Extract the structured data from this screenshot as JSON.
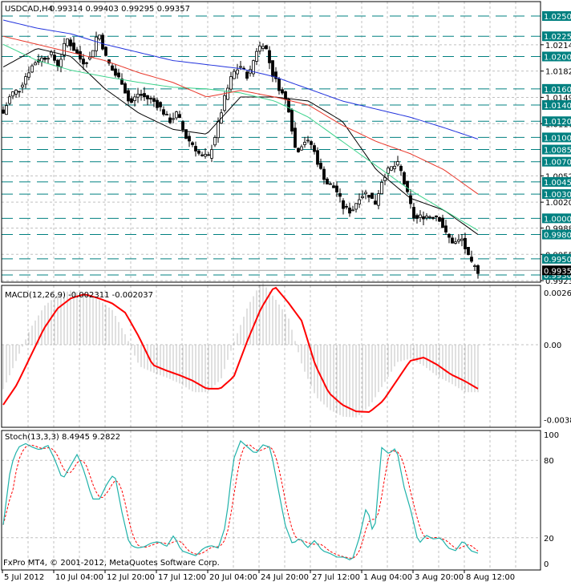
{
  "chart_data": [
    {
      "type": "candlestick",
      "title": "USDCAD,H4",
      "ohlc_text": [
        "0.99314",
        "0.99403",
        "0.99295",
        "0.99357"
      ],
      "current_price": "0.99357",
      "ylim": [
        0.9923,
        1.026
      ],
      "price_scale_labels": [
        "1.02145",
        "1.01820",
        "1.01495",
        "1.01170",
        "1.00525",
        "1.00200",
        "0.99880",
        "0.99555",
        "0.99230"
      ],
      "levels": [
        "1.02500",
        "1.02250",
        "1.02000",
        "1.01600",
        "1.01400",
        "1.01200",
        "1.01000",
        "1.00850",
        "1.00700",
        "1.00450",
        "1.00300",
        "1.00000",
        "0.99800",
        "0.99500",
        "0.99300"
      ],
      "bars": 149,
      "close_path": [
        1.013,
        1.0154,
        1.0159,
        1.0179,
        1.0193,
        1.0198,
        1.0203,
        1.0188,
        1.0223,
        1.0208,
        1.0193,
        1.0198,
        1.0232,
        1.0198,
        1.0179,
        1.0169,
        1.014,
        1.0154,
        1.0149,
        1.0145,
        1.0135,
        1.012,
        1.013,
        1.0101,
        1.0091,
        1.0076,
        1.0076,
        1.011,
        1.0149,
        1.0179,
        1.0188,
        1.0174,
        1.0208,
        1.0218,
        1.0179,
        1.0159,
        1.014,
        1.0081,
        1.0096,
        1.0091,
        1.0062,
        1.0042,
        1.0037,
        1.0013,
        1.0008,
        1.0027,
        1.0032,
        1.0018,
        1.0052,
        1.0062,
        1.0067,
        1.0032,
        0.9998,
        1.0003,
        1.0003,
        1.0003,
        0.9979,
        0.9969,
        0.9974,
        0.9945,
        0.9935
      ],
      "moving_averages": [
        {
          "name": "ma-black",
          "color": "#000000",
          "values": [
            1.0187,
            1.021,
            1.02,
            1.016,
            1.013,
            1.011,
            1.0104,
            1.015,
            1.015,
            1.0145,
            1.012,
            1.006,
            1.0025,
            1.001,
            0.998
          ]
        },
        {
          "name": "ma-green",
          "color": "#3CD38C",
          "values": [
            1.0215,
            1.0195,
            1.0183,
            1.0175,
            1.0168,
            1.0162,
            1.016,
            1.0155,
            1.0145,
            1.0125,
            1.0095,
            1.0065,
            1.0035,
            1.001,
            0.9985
          ]
        },
        {
          "name": "ma-red",
          "color": "#E8382B",
          "values": [
            1.0225,
            1.0215,
            1.0205,
            1.0195,
            1.018,
            1.0168,
            1.015,
            1.0158,
            1.015,
            1.014,
            1.0115,
            1.0095,
            1.008,
            1.006,
            1.003
          ]
        },
        {
          "name": "ma-blue",
          "color": "#2233DD",
          "values": [
            1.0245,
            1.0235,
            1.0228,
            1.0215,
            1.0205,
            1.0195,
            1.019,
            1.0185,
            1.0175,
            1.016,
            1.0145,
            1.0135,
            1.0125,
            1.0112,
            1.0098
          ]
        }
      ],
      "level_color": "#008080"
    },
    {
      "type": "macd",
      "label": "MACD(12,26,9) -0.002311 -0.002037",
      "ylim": [
        -0.00382,
        0.00265
      ],
      "tick_labels": [
        "0.00265",
        "0.00",
        "-0.00382"
      ],
      "signal": [
        -0.00306,
        -0.00204,
        -0.00061,
        0.00082,
        0.00184,
        0.00237,
        0.00257,
        0.00237,
        0.00212,
        0.00163,
        0.00041,
        -0.00102,
        -0.00131,
        -0.00155,
        -0.00184,
        -0.00224,
        -0.00224,
        -0.00163,
        0.0002,
        0.00184,
        0.00298,
        0.00216,
        0.00122,
        -0.00102,
        -0.00245,
        -0.00306,
        -0.00339,
        -0.00343,
        -0.00286,
        -0.00184,
        -0.00082,
        -0.00065,
        -0.00102,
        -0.00151,
        -0.00184,
        -0.00224
      ]
    },
    {
      "type": "stochastic",
      "label": "Stoch(13,3,3) 8.4945 9.2822",
      "ylim": [
        0,
        100
      ],
      "tick_labels": [
        "100",
        "80",
        "20",
        "0"
      ],
      "main": [
        30,
        75,
        90,
        93,
        90,
        88,
        92,
        80,
        65,
        75,
        85,
        70,
        50,
        50,
        62,
        70,
        40,
        15,
        12,
        13,
        16,
        17,
        13,
        22,
        10,
        8,
        6,
        12,
        14,
        12,
        30,
        80,
        95,
        90,
        85,
        92,
        90,
        60,
        30,
        15,
        20,
        12,
        18,
        10,
        8,
        5,
        5,
        2,
        20,
        45,
        20,
        90,
        85,
        90,
        60,
        40,
        15,
        22,
        19,
        20,
        12,
        10,
        18,
        10,
        8
      ]
    }
  ],
  "time_labels": [
    "5 Jul 2012",
    "10 Jul 04:00",
    "12 Jul 20:00",
    "17 Jul 12:00",
    "20 Jul 04:00",
    "24 Jul 20:00",
    "27 Jul 12:00",
    "1 Aug 04:00",
    "3 Aug 20:00",
    "8 Aug 12:00"
  ],
  "copyright": "FxPro MT4, © 2001-2012, MetaQuotes Software Corp."
}
